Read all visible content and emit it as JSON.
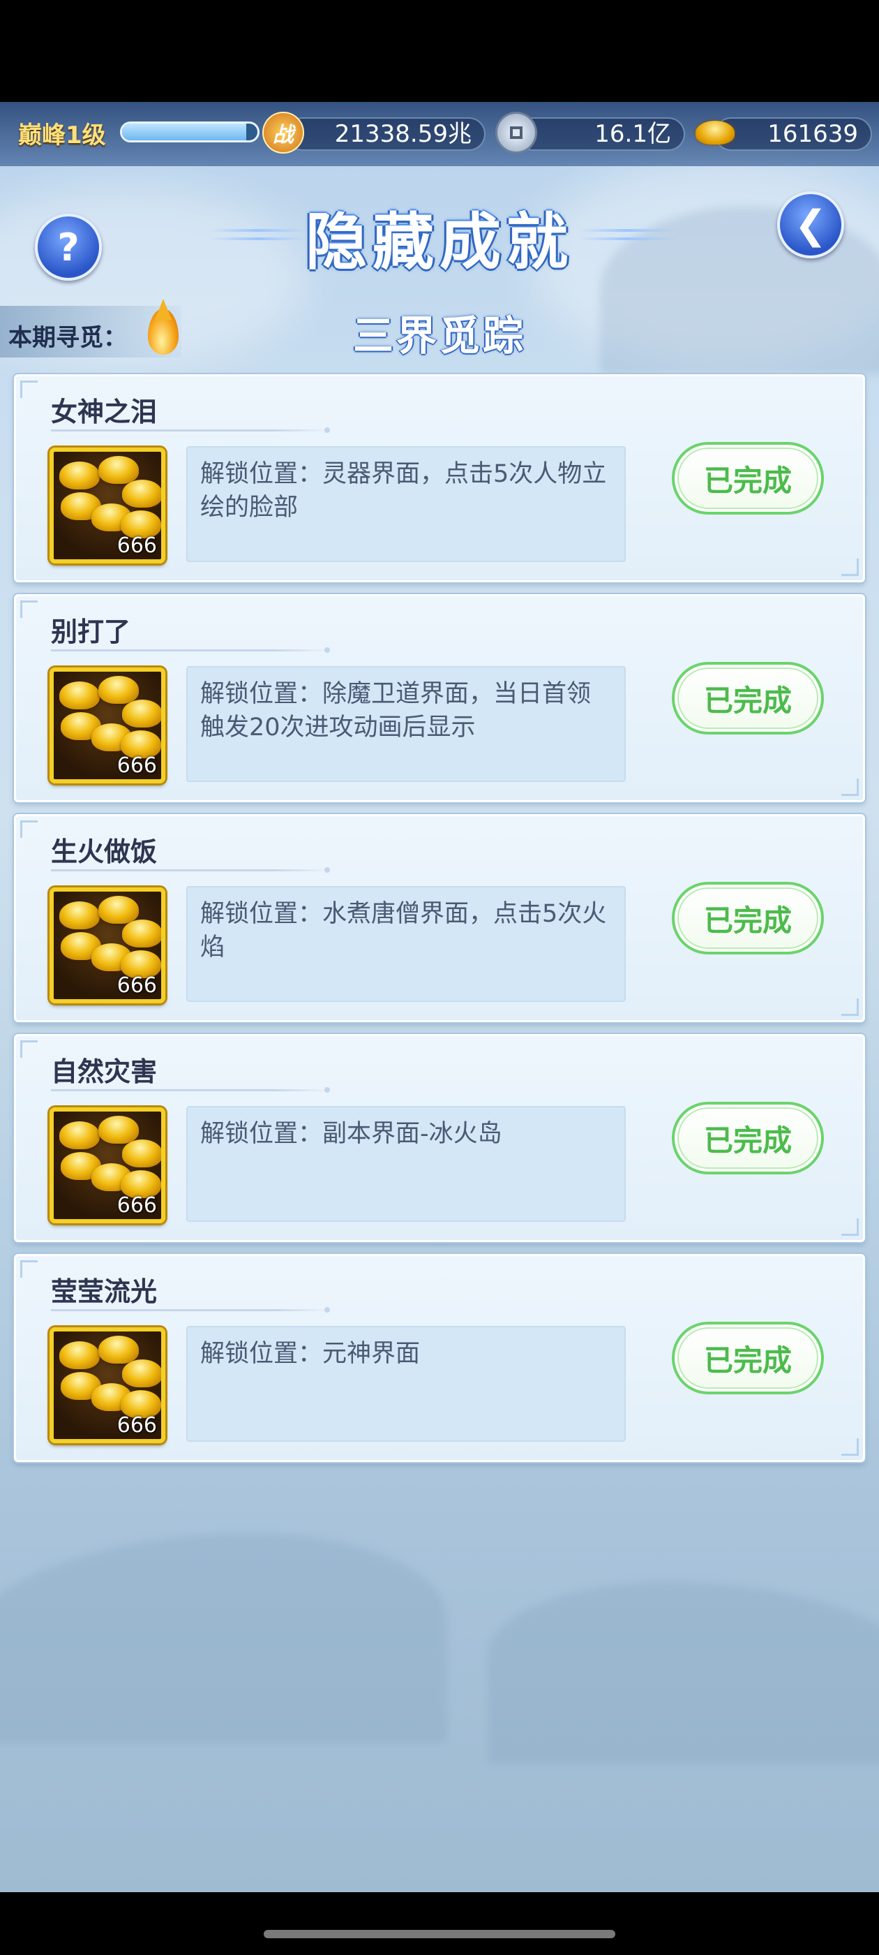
{
  "status_bar": {},
  "topbar": {
    "level": "巅峰1级",
    "exp_fraction": 0.92,
    "power": "21338.59兆",
    "coins": "16.1亿",
    "gold": "161639",
    "icons": [
      "zhan-power-icon",
      "copper-coin-icon",
      "gold-ingot-icon"
    ],
    "zhan_char": "战"
  },
  "header": {
    "title": "隐藏成就",
    "help_glyph": "?",
    "back_glyph": "❮",
    "period_label": "本期寻觅：",
    "subtitle": "三界觅踪"
  },
  "achievements": [
    {
      "name": "女神之泪",
      "reward_qty": "666",
      "desc": "解锁位置：灵器界面，点击5次人物立绘的脸部",
      "status": "已完成"
    },
    {
      "name": "别打了",
      "reward_qty": "666",
      "desc": "解锁位置：除魔卫道界面，当日首领触发20次进攻动画后显示",
      "status": "已完成"
    },
    {
      "name": "生火做饭",
      "reward_qty": "666",
      "desc": "解锁位置：水煮唐僧界面，点击5次火焰",
      "status": "已完成"
    },
    {
      "name": "自然灾害",
      "reward_qty": "666",
      "desc": "解锁位置：副本界面-冰火岛",
      "status": "已完成"
    },
    {
      "name": "莹莹流光",
      "reward_qty": "666",
      "desc": "解锁位置：元神界面",
      "status": "已完成"
    }
  ],
  "colors": {
    "title_stroke": "#2c5fb4",
    "done_green": "#4cbb4c",
    "reward_border": "#f4cf27"
  }
}
